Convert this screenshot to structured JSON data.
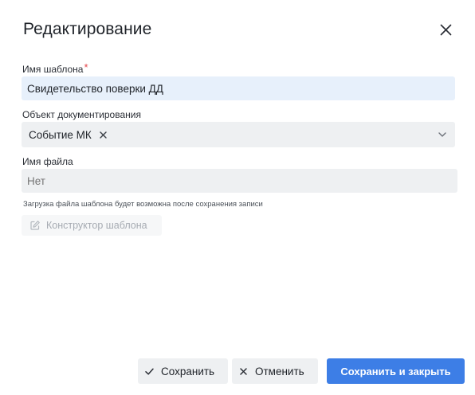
{
  "dialog": {
    "title": "Редактирование",
    "close_icon": "close-icon"
  },
  "form": {
    "template_name": {
      "label": "Имя шаблона",
      "required_mark": "*",
      "value": "Свидетельство поверки ДД"
    },
    "doc_object": {
      "label": "Объект документирования",
      "tags": [
        "Событие МК"
      ],
      "remove_icon": "close-icon",
      "dropdown_icon": "chevron-down-icon"
    },
    "file_name": {
      "label": "Имя файла",
      "placeholder": "Нет"
    },
    "hint": "Загрузка файла шаблона будет возможна после сохранения записи",
    "builder_button": {
      "label": "Конструктор шаблона",
      "icon": "edit-icon"
    }
  },
  "footer": {
    "save_label": "Сохранить",
    "cancel_label": "Отменить",
    "save_close_label": "Сохранить и закрыть"
  },
  "colors": {
    "primary": "#3d7ee6",
    "required": "#e5484d",
    "field_active": "#e7f0fb",
    "field_bg": "#eef0f2"
  }
}
